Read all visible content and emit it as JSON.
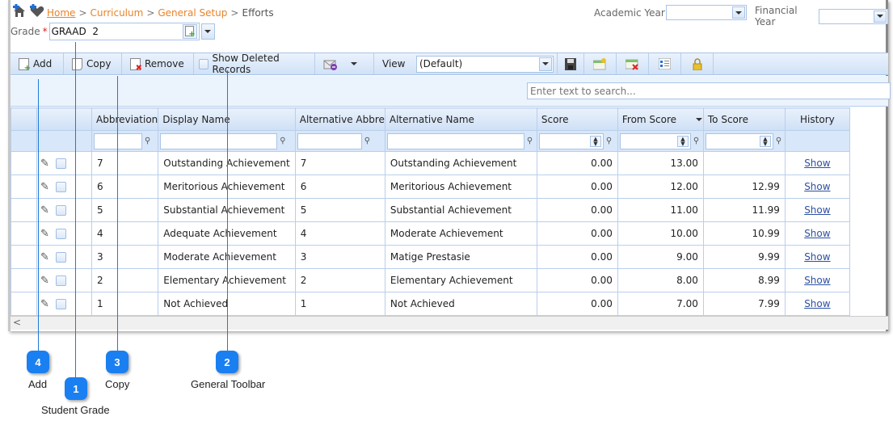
{
  "breadcrumb": {
    "home": "Home",
    "curriculum": "Curriculum",
    "general_setup": "General Setup",
    "current": "Efforts",
    "separator": ">"
  },
  "grade": {
    "label": "Grade",
    "required_mark": "*",
    "value": "GRAAD  2"
  },
  "academic_year": {
    "label": "Academic Year",
    "value": ""
  },
  "financial_year": {
    "label": "Financial Year",
    "value": ""
  },
  "toolbar": {
    "add": "Add",
    "copy": "Copy",
    "remove": "Remove",
    "show_deleted": "Show Deleted Records",
    "view_label": "View",
    "view_value": "(Default)"
  },
  "search": {
    "placeholder": "Enter text to search..."
  },
  "columns": [
    "Abbreviation",
    "Display Name",
    "Alternative Abbre",
    "Alternative Name",
    "Score",
    "From Score",
    "To Score",
    "History"
  ],
  "rows": [
    {
      "abbr": "7",
      "display": "Outstanding Achievement",
      "alt_abbr": "7",
      "alt_name": "Outstanding Achievement",
      "score": "0.00",
      "from": "13.00",
      "to": "",
      "history": "Show"
    },
    {
      "abbr": "6",
      "display": "Meritorious Achievement",
      "alt_abbr": "6",
      "alt_name": "Meritorious Achievement",
      "score": "0.00",
      "from": "12.00",
      "to": "12.99",
      "history": "Show"
    },
    {
      "abbr": "5",
      "display": "Substantial Achievement",
      "alt_abbr": "5",
      "alt_name": "Substantial Achievement",
      "score": "0.00",
      "from": "11.00",
      "to": "11.99",
      "history": "Show"
    },
    {
      "abbr": "4",
      "display": "Adequate Achievement",
      "alt_abbr": "4",
      "alt_name": "Moderate Achievement",
      "score": "0.00",
      "from": "10.00",
      "to": "10.99",
      "history": "Show"
    },
    {
      "abbr": "3",
      "display": "Moderate Achievement",
      "alt_abbr": "3",
      "alt_name": "Matige Prestasie",
      "score": "0.00",
      "from": "9.00",
      "to": "9.99",
      "history": "Show"
    },
    {
      "abbr": "2",
      "display": "Elementary Achievement",
      "alt_abbr": "2",
      "alt_name": "Elementary Achievement",
      "score": "0.00",
      "from": "8.00",
      "to": "8.99",
      "history": "Show"
    },
    {
      "abbr": "1",
      "display": "Not Achieved",
      "alt_abbr": "1",
      "alt_name": "Not Achieved",
      "score": "0.00",
      "from": "7.00",
      "to": "7.99",
      "history": "Show"
    }
  ],
  "scroll_left": "<",
  "callouts": [
    {
      "num": "4",
      "label": "Add"
    },
    {
      "num": "1",
      "label": "Student Grade"
    },
    {
      "num": "3",
      "label": "Copy"
    },
    {
      "num": "2",
      "label": "General Toolbar"
    }
  ],
  "colors": {
    "accent": "#1a7ff0",
    "link_orange": "#e8832a",
    "link_blue": "#2d4fa1"
  }
}
